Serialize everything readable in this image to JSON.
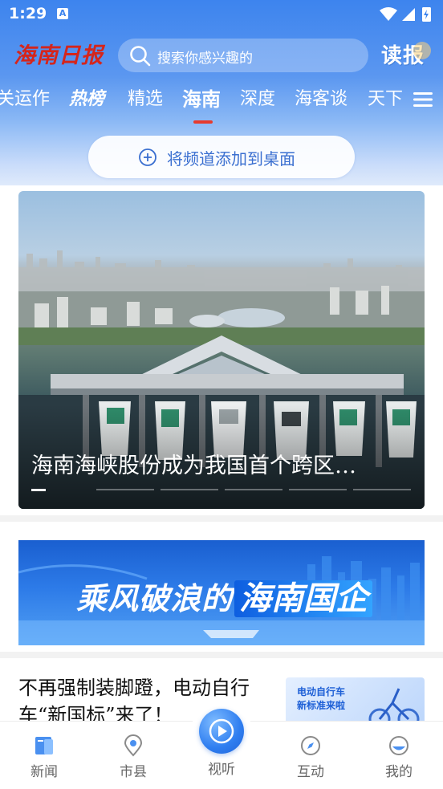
{
  "status_bar": {
    "time": "1:29",
    "notification_letter": "A",
    "icons": [
      "wifi-icon",
      "signal-icon",
      "battery-charging-icon"
    ]
  },
  "header": {
    "logo_text": "海南日报",
    "search_placeholder": "搜索你感兴趣的",
    "read_label": "读报",
    "add_desktop_label": "将频道添加到桌面"
  },
  "tabs": [
    {
      "label": "关运作",
      "state": "normal"
    },
    {
      "label": "热榜",
      "state": "hot"
    },
    {
      "label": "精选",
      "state": "normal"
    },
    {
      "label": "海南",
      "state": "active"
    },
    {
      "label": "深度",
      "state": "normal"
    },
    {
      "label": "海客谈",
      "state": "normal"
    },
    {
      "label": "天下",
      "state": "normal"
    }
  ],
  "hero": {
    "title": "海南海峡股份成为我国首个跨区…",
    "slide_count": 6,
    "active_slide": 1
  },
  "banner": {
    "text_part1": "乘风破浪的",
    "text_part2": "海南国企"
  },
  "article": {
    "title": "不再强制装脚蹬，电动自行车“新国标”来了！",
    "thumb_line1": "电动自行车",
    "thumb_line2": "新标准来啦"
  },
  "bottom_nav": [
    {
      "label": "新闻",
      "icon": "news-icon",
      "active": true
    },
    {
      "label": "市县",
      "icon": "location-pin-icon",
      "active": false
    },
    {
      "label": "视听",
      "icon": "play-icon",
      "active": false
    },
    {
      "label": "互动",
      "icon": "compass-icon",
      "active": false
    },
    {
      "label": "我的",
      "icon": "profile-icon",
      "active": false
    }
  ],
  "colors": {
    "header_blue": "#3d84ee",
    "tab_indicator": "#e63b2e",
    "logo_red": "#d5251b",
    "accent_blue": "#2f7ef0"
  }
}
